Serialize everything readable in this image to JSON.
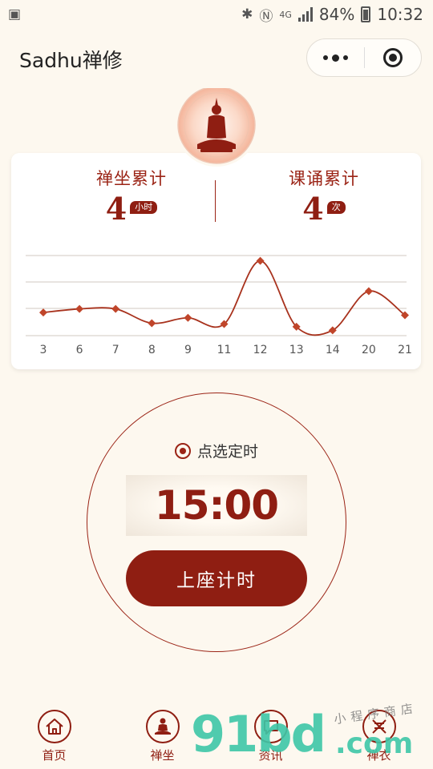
{
  "status_bar": {
    "battery_percent": "84%",
    "time": "10:32",
    "network": "4G"
  },
  "header": {
    "title": "Sadhu禅修"
  },
  "stats": {
    "meditation": {
      "label": "禅坐累计",
      "value": "4",
      "unit": "小时"
    },
    "chanting": {
      "label": "课诵累计",
      "value": "4",
      "unit": "次"
    }
  },
  "chart_data": {
    "type": "line",
    "categories": [
      "3",
      "6",
      "7",
      "8",
      "9",
      "11",
      "12",
      "13",
      "14",
      "20",
      "21"
    ],
    "series": [
      {
        "values": [
          1.0,
          1.2,
          1.2,
          0.4,
          0.7,
          0.35,
          3.9,
          0.2,
          0.0,
          2.2,
          0.85
        ]
      }
    ],
    "grid": true,
    "smooth": true,
    "ylim": [
      -0.3,
      4.2
    ],
    "line_color": "#a8321d",
    "marker": "diamond"
  },
  "timer": {
    "pick_label": "点选定时",
    "time": "15:00",
    "start_label": "上座计时"
  },
  "tabbar": {
    "items": [
      {
        "label": "首页",
        "icon": "home-icon"
      },
      {
        "label": "禅坐",
        "icon": "meditate-icon"
      },
      {
        "label": "资讯",
        "icon": "news-icon"
      },
      {
        "label": "禅衣",
        "icon": "robe-icon"
      }
    ]
  },
  "watermark": {
    "big": "91bd",
    "com": ".com",
    "small": "小程序商店"
  },
  "colors": {
    "primary": "#8f1e12",
    "background": "#fdf8ef",
    "watermark": "#3ec7a8"
  }
}
